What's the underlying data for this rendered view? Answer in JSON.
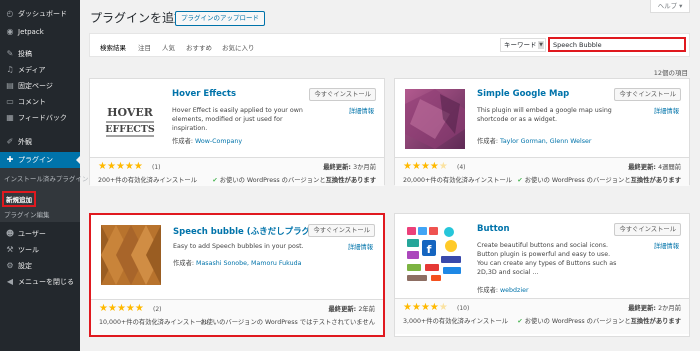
{
  "sidebar": {
    "items": [
      {
        "label": "ダッシュボード",
        "icon": "dashboard-icon"
      },
      {
        "label": "Jetpack",
        "icon": "jetpack-icon"
      },
      {
        "label": "投稿",
        "icon": "pin-icon"
      },
      {
        "label": "メディア",
        "icon": "media-icon"
      },
      {
        "label": "固定ページ",
        "icon": "page-icon"
      },
      {
        "label": "コメント",
        "icon": "comment-icon"
      },
      {
        "label": "フィードバック",
        "icon": "feedback-icon"
      },
      {
        "label": "外観",
        "icon": "brush-icon"
      },
      {
        "label": "プラグイン",
        "icon": "plugin-icon"
      },
      {
        "label": "ユーザー",
        "icon": "user-icon"
      },
      {
        "label": "ツール",
        "icon": "wrench-icon"
      },
      {
        "label": "設定",
        "icon": "settings-icon"
      },
      {
        "label": "メニューを閉じる",
        "icon": "collapse-icon"
      }
    ],
    "submenu": [
      "インストール済みプラグイン",
      "新規追加",
      "プラグイン編集"
    ]
  },
  "header": {
    "title": "プラグインを追加",
    "upload_label": "プラグインのアップロード",
    "help_label": "ヘルプ ▾"
  },
  "filter": {
    "tabs": [
      "検索結果",
      "注目",
      "人気",
      "おすすめ",
      "お気に入り"
    ],
    "search_type": "キーワード",
    "search_value": "Speech Bubble"
  },
  "item_count": "12個の項目",
  "common": {
    "install_label": "今すぐインストール",
    "details_label": "詳細情報",
    "author_prefix": "作成者: ",
    "updated_prefix": "最終更新: ",
    "compat_prefix": "お使いの WordPress のバージョンと",
    "compat_strong": "互換性があります"
  },
  "plugins": [
    {
      "name": "Hover Effects",
      "description": "Hover Effect is easily applied to your own elements, modified or just used for inspiration.",
      "author": "Wow-Company",
      "rating": 5,
      "rating_count": "(1)",
      "installs": "200+件の有効化済みインストール",
      "updated": "3か月前",
      "compat_text": "お使いの WordPress のバージョンと",
      "compat_strong": "互換性があります"
    },
    {
      "name": "Simple Google Map",
      "description": "This plugin will embed a google map using shortcode or as a widget.",
      "author": "Taylor Gorman, Glenn Welser",
      "rating": 4,
      "rating_count": "(4)",
      "installs": "20,000+件の有効化済みインストール",
      "updated": "4週間前",
      "compat_text": "お使いの WordPress のバージョンと",
      "compat_strong": "互換性があります"
    },
    {
      "name": "Speech bubble (ふきだしプラグイン)",
      "description": "Easy to add Speech bubbles in your post.",
      "author": "Masashi Sonobe, Mamoru Fukuda",
      "rating": 5,
      "rating_count": "(2)",
      "installs": "10,000+件の有効化済みインストール",
      "updated": "2年前",
      "compat_text": "お使いのバージョンの WordPress ではテストされていません",
      "compat_strong": ""
    },
    {
      "name": "Button",
      "description": "Create beautiful buttons and social icons. Button plugin is powerful and easy to use. You can create any types of Buttons such as 2D,3D and social ...",
      "author": "webdzier",
      "rating": 4,
      "rating_count": "(10)",
      "installs": "3,000+件の有効化済みインストール",
      "updated": "2か月前",
      "compat_text": "お使いの WordPress のバージョンと",
      "compat_strong": "互換性があります"
    }
  ],
  "thumb_texts": {
    "hover_line1": "HOVER",
    "hover_line2": "EFFECTS"
  },
  "colors": {
    "accent": "#0073aa",
    "highlight": "#e0191f",
    "star": "#ffb900",
    "sidebar_bg": "#23282d"
  }
}
